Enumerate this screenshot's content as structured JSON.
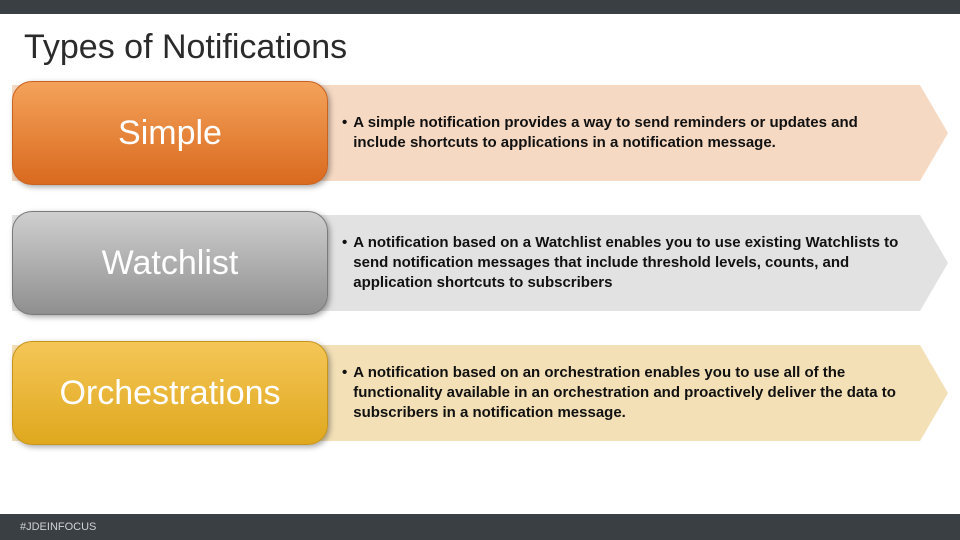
{
  "title": "Types of Notifications",
  "rows": [
    {
      "label": "Simple",
      "desc": "A simple notification provides a way to send reminders or updates and include shortcuts to applications in a notification message."
    },
    {
      "label": "Watchlist",
      "desc": "A notification based on a Watchlist enables you to use existing Watchlists to send notification messages that include threshold levels, counts, and application shortcuts to subscribers"
    },
    {
      "label": "Orchestrations",
      "desc": "A notification based on an orchestration enables you to use all of the functionality available in an orchestration and proactively deliver the data to subscribers in a notification message."
    }
  ],
  "footer": "#JDEINFOCUS"
}
